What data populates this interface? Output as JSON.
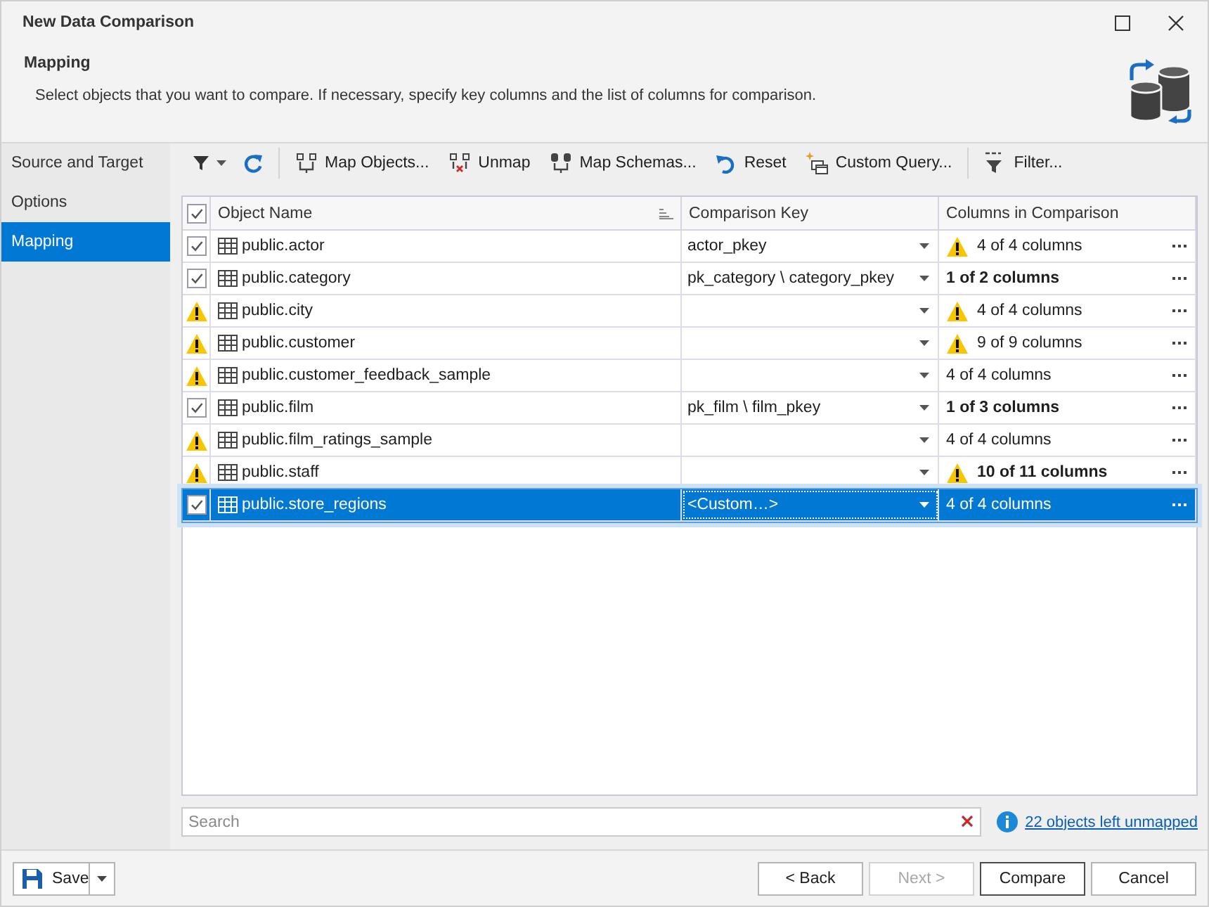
{
  "window": {
    "title": "New Data Comparison"
  },
  "header": {
    "title": "Mapping",
    "description": "Select objects that you want to compare. If necessary, specify key columns and the list of columns for comparison."
  },
  "sidebar": {
    "items": [
      {
        "label": "Source and Target",
        "selected": false
      },
      {
        "label": "Options",
        "selected": false
      },
      {
        "label": "Mapping",
        "selected": true
      }
    ]
  },
  "toolbar": {
    "groups": [
      [
        {
          "kind": "filter-menu"
        },
        {
          "kind": "refresh"
        }
      ],
      [
        {
          "kind": "map",
          "label": "Map Objects..."
        },
        {
          "kind": "unmap",
          "label": "Unmap"
        },
        {
          "kind": "map-schemas",
          "label": "Map Schemas..."
        },
        {
          "kind": "reset",
          "label": "Reset"
        },
        {
          "kind": "custom-query",
          "label": "Custom Query..."
        }
      ],
      [
        {
          "kind": "sql-filter",
          "label": "Filter..."
        }
      ]
    ]
  },
  "table": {
    "header_checkbox": {
      "checked": true
    },
    "columns": [
      "Object Name",
      "Comparison Key",
      "Columns in Comparison"
    ],
    "rows": [
      {
        "kind": "checkbox",
        "checked": true,
        "name": "public.actor",
        "key": "actor_pkey",
        "columns": "4 of 4 columns",
        "columns_bold": false,
        "columns_warning": true,
        "selected": false
      },
      {
        "kind": "checkbox",
        "checked": true,
        "name": "public.category",
        "key": "pk_category \\ category_pkey",
        "columns": "1 of 2 columns",
        "columns_bold": true,
        "columns_warning": false,
        "selected": false
      },
      {
        "kind": "warning",
        "name": "public.city",
        "columns": "4 of 4 columns",
        "columns_bold": false,
        "columns_warning": true,
        "selected": false
      },
      {
        "kind": "warning",
        "name": "public.customer",
        "columns": "9 of 9 columns",
        "columns_bold": false,
        "columns_warning": true,
        "selected": false
      },
      {
        "kind": "warning",
        "name": "public.customer_feedback_sample",
        "columns": "4 of 4 columns",
        "columns_bold": false,
        "columns_warning": false,
        "selected": false
      },
      {
        "kind": "checkbox",
        "checked": true,
        "name": "public.film",
        "key": "pk_film \\ film_pkey",
        "columns": "1 of 3 columns",
        "columns_bold": true,
        "columns_warning": false,
        "selected": false
      },
      {
        "kind": "warning",
        "name": "public.film_ratings_sample",
        "columns": "4 of 4 columns",
        "columns_bold": false,
        "columns_warning": false,
        "selected": false
      },
      {
        "kind": "warning",
        "name": "public.staff",
        "columns": "10 of 11 columns",
        "columns_bold": true,
        "columns_warning": true,
        "selected": false
      },
      {
        "kind": "checkbox",
        "checked": true,
        "name": "public.store_regions",
        "key": "<Custom…>",
        "columns": "4 of 4 columns",
        "columns_bold": false,
        "columns_warning": false,
        "selected": true
      }
    ]
  },
  "search": {
    "placeholder": "Search"
  },
  "info_link": "22 objects left unmapped",
  "footer": {
    "save_button": "Save",
    "buttons": [
      {
        "label": "< Back",
        "disabled": false,
        "default": false
      },
      {
        "label": "Next >",
        "disabled": true,
        "default": false
      },
      {
        "label": "Compare",
        "disabled": false,
        "default": true
      },
      {
        "label": "Cancel",
        "disabled": false,
        "default": false
      }
    ]
  }
}
